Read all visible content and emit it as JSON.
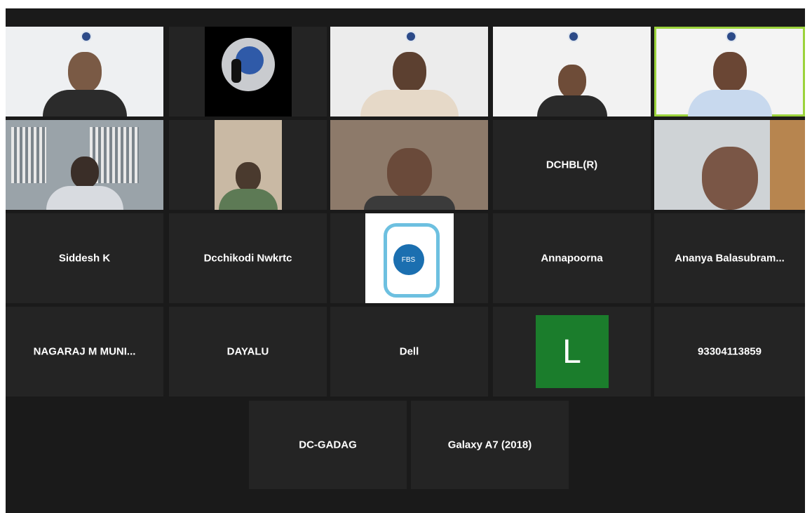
{
  "window": {
    "title": ""
  },
  "tiles": [
    {
      "id": "p1",
      "type": "video"
    },
    {
      "id": "p2",
      "type": "logo"
    },
    {
      "id": "p3",
      "type": "video"
    },
    {
      "id": "p4",
      "type": "video"
    },
    {
      "id": "p5",
      "type": "video",
      "active": true
    },
    {
      "id": "p6",
      "type": "video"
    },
    {
      "id": "p7",
      "type": "video"
    },
    {
      "id": "p8",
      "type": "video"
    },
    {
      "id": "p9",
      "type": "name",
      "label": "DCHBL(R)"
    },
    {
      "id": "p10",
      "type": "video"
    },
    {
      "id": "p11",
      "type": "name",
      "label": "Siddesh K"
    },
    {
      "id": "p12",
      "type": "name",
      "label": "Dcchikodi Nwkrtc"
    },
    {
      "id": "p13",
      "type": "logo",
      "logo_text": "FBS"
    },
    {
      "id": "p14",
      "type": "name",
      "label": "Annapoorna"
    },
    {
      "id": "p15",
      "type": "name",
      "label": "Ananya Balasubram..."
    },
    {
      "id": "p16",
      "type": "name",
      "label": "NAGARAJ M MUNI..."
    },
    {
      "id": "p17",
      "type": "name",
      "label": "DAYALU"
    },
    {
      "id": "p18",
      "type": "name",
      "label": "Dell"
    },
    {
      "id": "p19",
      "type": "avatar",
      "initial": "L",
      "color": "#1b7d2c"
    },
    {
      "id": "p20",
      "type": "name",
      "label": "93304113859"
    },
    {
      "id": "p21",
      "type": "name",
      "label": "DC-GADAG"
    },
    {
      "id": "p22",
      "type": "name",
      "label": "Galaxy A7 (2018)"
    }
  ],
  "colors": {
    "background": "#1a1a1a",
    "tile": "#242424",
    "active_border": "#9bd33b",
    "avatar_green": "#1b7d2c"
  }
}
